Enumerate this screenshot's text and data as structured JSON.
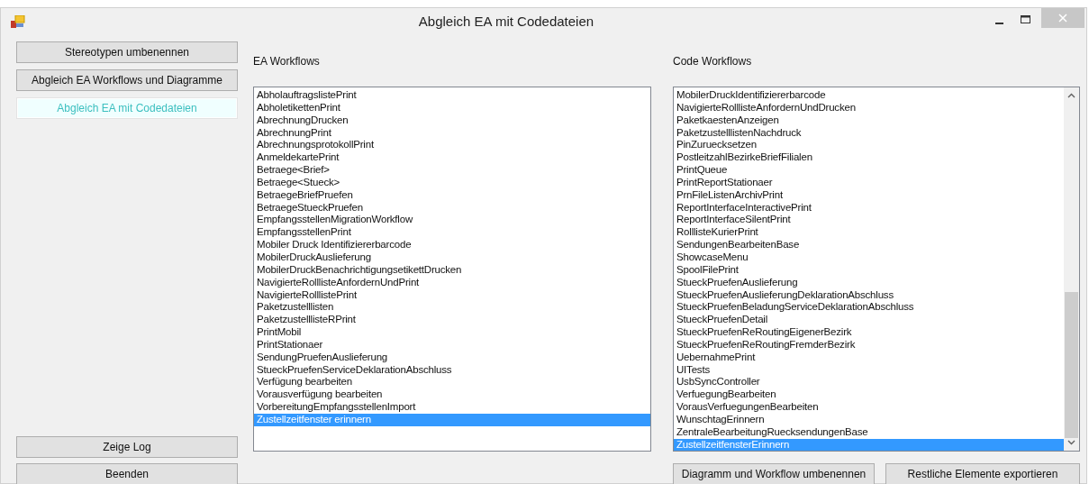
{
  "window": {
    "title": "Abgleich EA mit Codedateien"
  },
  "nav_buttons": [
    {
      "label": "Stereotypen umbenennen",
      "selected": false
    },
    {
      "label": "Abgleich EA Workflows und Diagramme",
      "selected": false
    },
    {
      "label": "Abgleich EA mit Codedateien",
      "selected": true
    }
  ],
  "bottom_left_buttons": [
    "Zeige Log",
    "Beenden"
  ],
  "ea_workflows": {
    "label": "EA Workflows",
    "items": [
      {
        "text": "AbholauftragslistePrint",
        "selected": false
      },
      {
        "text": "AbholetikettenPrint",
        "selected": false
      },
      {
        "text": "AbrechnungDrucken",
        "selected": false
      },
      {
        "text": "AbrechnungPrint",
        "selected": false
      },
      {
        "text": "AbrechnungsprotokollPrint",
        "selected": false
      },
      {
        "text": "AnmeldekartePrint",
        "selected": false
      },
      {
        "text": "Betraege<Brief>",
        "selected": false
      },
      {
        "text": "Betraege<Stueck>",
        "selected": false
      },
      {
        "text": "BetraegeBriefPruefen",
        "selected": false
      },
      {
        "text": "BetraegeStueckPruefen",
        "selected": false
      },
      {
        "text": "EmpfangsstellenMigrationWorkflow",
        "selected": false
      },
      {
        "text": "EmpfangsstellenPrint",
        "selected": false
      },
      {
        "text": "Mobiler Druck Identifiziererbarcode",
        "selected": false
      },
      {
        "text": "MobilerDruckAuslieferung",
        "selected": false
      },
      {
        "text": "MobilerDruckBenachrichtigungsetikettDrucken",
        "selected": false
      },
      {
        "text": "NavigierteRolllisteAnfordernUndPrint",
        "selected": false
      },
      {
        "text": "NavigierteRolllistePrint",
        "selected": false
      },
      {
        "text": "Paketzustelllisten",
        "selected": false
      },
      {
        "text": "PaketzustelllisteRPrint",
        "selected": false
      },
      {
        "text": "PrintMobil",
        "selected": false
      },
      {
        "text": "PrintStationaer",
        "selected": false
      },
      {
        "text": "SendungPruefenAuslieferung",
        "selected": false
      },
      {
        "text": "StueckPruefenServiceDeklarationAbschluss",
        "selected": false
      },
      {
        "text": "Verfügung bearbeiten",
        "selected": false
      },
      {
        "text": "Vorausverfügung bearbeiten",
        "selected": false
      },
      {
        "text": "VorbereitungEmpfangsstellenImport",
        "selected": false
      },
      {
        "text": "Zustellzeitfenster erinnern",
        "selected": true
      }
    ]
  },
  "code_workflows": {
    "label": "Code Workflows",
    "items": [
      {
        "text": "MobilerDruckIdentifiziererbarcode",
        "selected": false
      },
      {
        "text": "NavigierteRolllisteAnfordernUndDrucken",
        "selected": false
      },
      {
        "text": "PaketkaestenAnzeigen",
        "selected": false
      },
      {
        "text": "PaketzustelllistenNachdruck",
        "selected": false
      },
      {
        "text": "PinZuruecksetzen",
        "selected": false
      },
      {
        "text": "PostleitzahlBezirkeBriefFilialen",
        "selected": false
      },
      {
        "text": "PrintQueue",
        "selected": false
      },
      {
        "text": "PrintReportStationaer",
        "selected": false
      },
      {
        "text": "PrnFileListenArchivPrint",
        "selected": false
      },
      {
        "text": "ReportInterfaceInteractivePrint",
        "selected": false
      },
      {
        "text": "ReportInterfaceSilentPrint",
        "selected": false
      },
      {
        "text": "RolllisteKurierPrint",
        "selected": false
      },
      {
        "text": "SendungenBearbeitenBase",
        "selected": false
      },
      {
        "text": "ShowcaseMenu",
        "selected": false
      },
      {
        "text": "SpoolFilePrint",
        "selected": false
      },
      {
        "text": "StueckPruefenAuslieferung",
        "selected": false
      },
      {
        "text": "StueckPruefenAuslieferungDeklarationAbschluss",
        "selected": false
      },
      {
        "text": "StueckPruefenBeladungServiceDeklarationAbschluss",
        "selected": false
      },
      {
        "text": "StueckPruefenDetail",
        "selected": false
      },
      {
        "text": "StueckPruefenReRoutingEigenerBezirk",
        "selected": false
      },
      {
        "text": "StueckPruefenReRoutingFremderBezirk",
        "selected": false
      },
      {
        "text": "UebernahmePrint",
        "selected": false
      },
      {
        "text": "UITests",
        "selected": false
      },
      {
        "text": "UsbSyncController",
        "selected": false
      },
      {
        "text": "VerfuegungBearbeiten",
        "selected": false
      },
      {
        "text": "VorausVerfuegungenBearbeiten",
        "selected": false
      },
      {
        "text": "WunschtagErinnern",
        "selected": false
      },
      {
        "text": "ZentraleBearbeitungRuecksendungenBase",
        "selected": false
      },
      {
        "text": "ZustellzeitfensterErinnern",
        "selected": true
      }
    ]
  },
  "bottom_right_buttons": [
    "Diagramm und Workflow umbenennen",
    "Restliche Elemente exportieren"
  ]
}
